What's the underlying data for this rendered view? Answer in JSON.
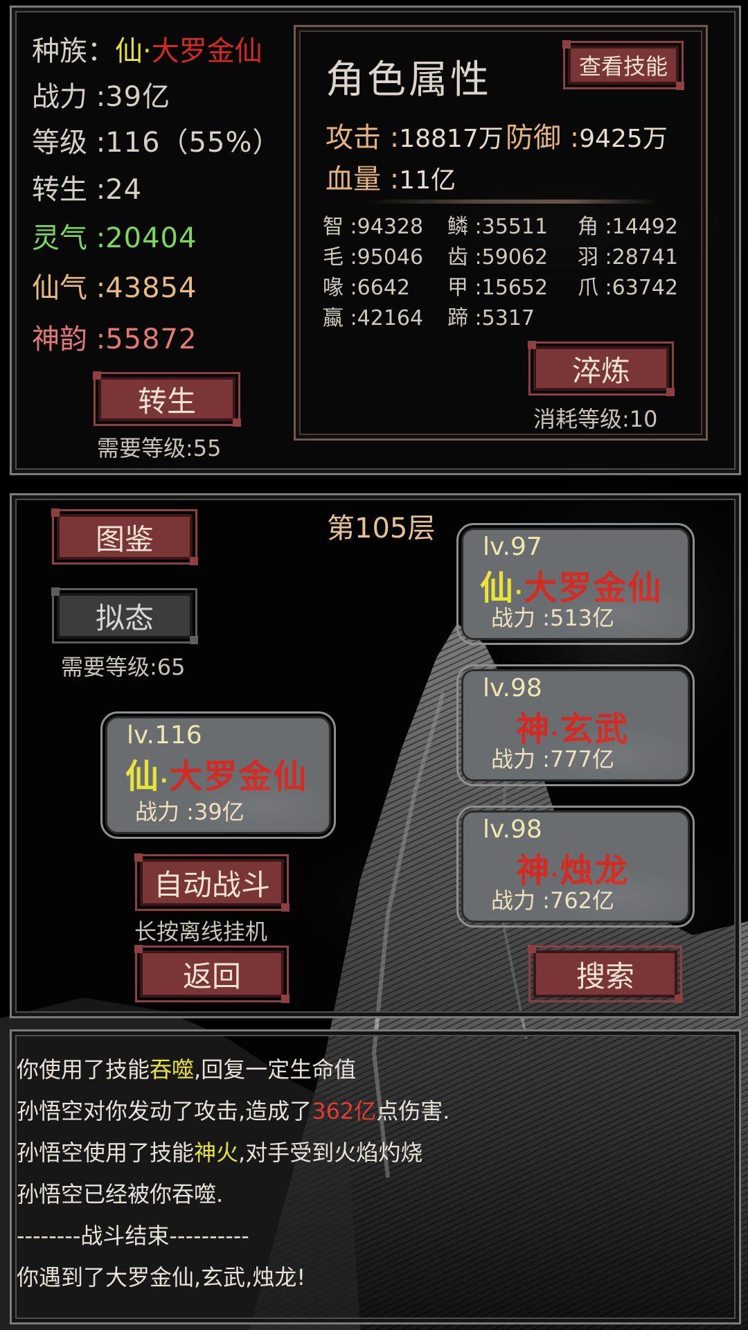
{
  "profile": {
    "race_label": "种族：",
    "race_prefix": "仙",
    "race_dot": "·",
    "race_name": "大罗金仙",
    "power_label": "战力 :",
    "power_value": "39亿",
    "level_label": "等级 :",
    "level_value": "116（55%）",
    "rebirth_label": "转生 :",
    "rebirth_value": "24",
    "lingqi_label": "灵气 :",
    "lingqi_value": "20404",
    "xianqi_label": "仙气 :",
    "xianqi_value": "43854",
    "shenyun_label": "神韵 :",
    "shenyun_value": "55872",
    "rebirth_button": "转生",
    "rebirth_requirement": "需要等级:55"
  },
  "attributes": {
    "title": "角色属性",
    "view_skills_button": "查看技能",
    "attack_label": "攻击 :",
    "attack_value": "18817万",
    "defense_label": "防御 :",
    "defense_value": "9425万",
    "hp_label": "血量 :",
    "hp_value": "11亿",
    "stats": [
      {
        "label": "智 :",
        "value": "94328"
      },
      {
        "label": "鳞 :",
        "value": "35511"
      },
      {
        "label": "角 :",
        "value": "14492"
      },
      {
        "label": "毛 :",
        "value": "95046"
      },
      {
        "label": "齿 :",
        "value": "59062"
      },
      {
        "label": "羽 :",
        "value": "28741"
      },
      {
        "label": "喙 :",
        "value": "6642"
      },
      {
        "label": "甲 :",
        "value": "15652"
      },
      {
        "label": "爪 :",
        "value": "63742"
      },
      {
        "label": "蠃 :",
        "value": "42164"
      },
      {
        "label": "蹄 :",
        "value": "5317"
      }
    ],
    "temper_button": "淬炼",
    "temper_cost": "消耗等级:10"
  },
  "battle": {
    "floor": "第105层",
    "codex_button": "图鉴",
    "mimic_button": "拟态",
    "mimic_requirement": "需要等级:65",
    "player": {
      "level": "lv.116",
      "prefix": "仙",
      "dot": "·",
      "name": "大罗金仙",
      "power": "战力 :39亿"
    },
    "enemies": [
      {
        "level": "lv.97",
        "prefix": "仙",
        "dot": "·",
        "name": "大罗金仙",
        "power": "战力 :513亿"
      },
      {
        "level": "lv.98",
        "prefix": "神",
        "dot": "·",
        "name": "玄武",
        "power": "战力 :777亿"
      },
      {
        "level": "lv.98",
        "prefix": "神",
        "dot": "·",
        "name": "烛龙",
        "power": "战力 :762亿"
      }
    ],
    "auto_battle_button": "自动战斗",
    "auto_battle_hint": "长按离线挂机",
    "back_button": "返回",
    "search_button": "搜索"
  },
  "log": {
    "line1_a": "你使用了技能",
    "line1_b": "吞噬",
    "line1_c": ",回复一定生命值",
    "line2_a": "孙悟空对你发动了攻击,造成了",
    "line2_b": "362亿",
    "line2_c": "点伤害.",
    "line3_a": "孙悟空使用了技能",
    "line3_b": "神火",
    "line3_c": ",对手受到火焰灼烧",
    "line4": "孙悟空已经被你吞噬.",
    "line5": "--------战斗结束----------",
    "line6": "你遇到了大罗金仙,玄武,烛龙!"
  },
  "colors": {
    "button_red": "#7a3637",
    "card_gray": "#6a6d70",
    "highlight_yellow": "#e7e33c",
    "highlight_red": "#d42a22",
    "spirit_green": "#7dd95b",
    "gold": "#e9bb80"
  }
}
